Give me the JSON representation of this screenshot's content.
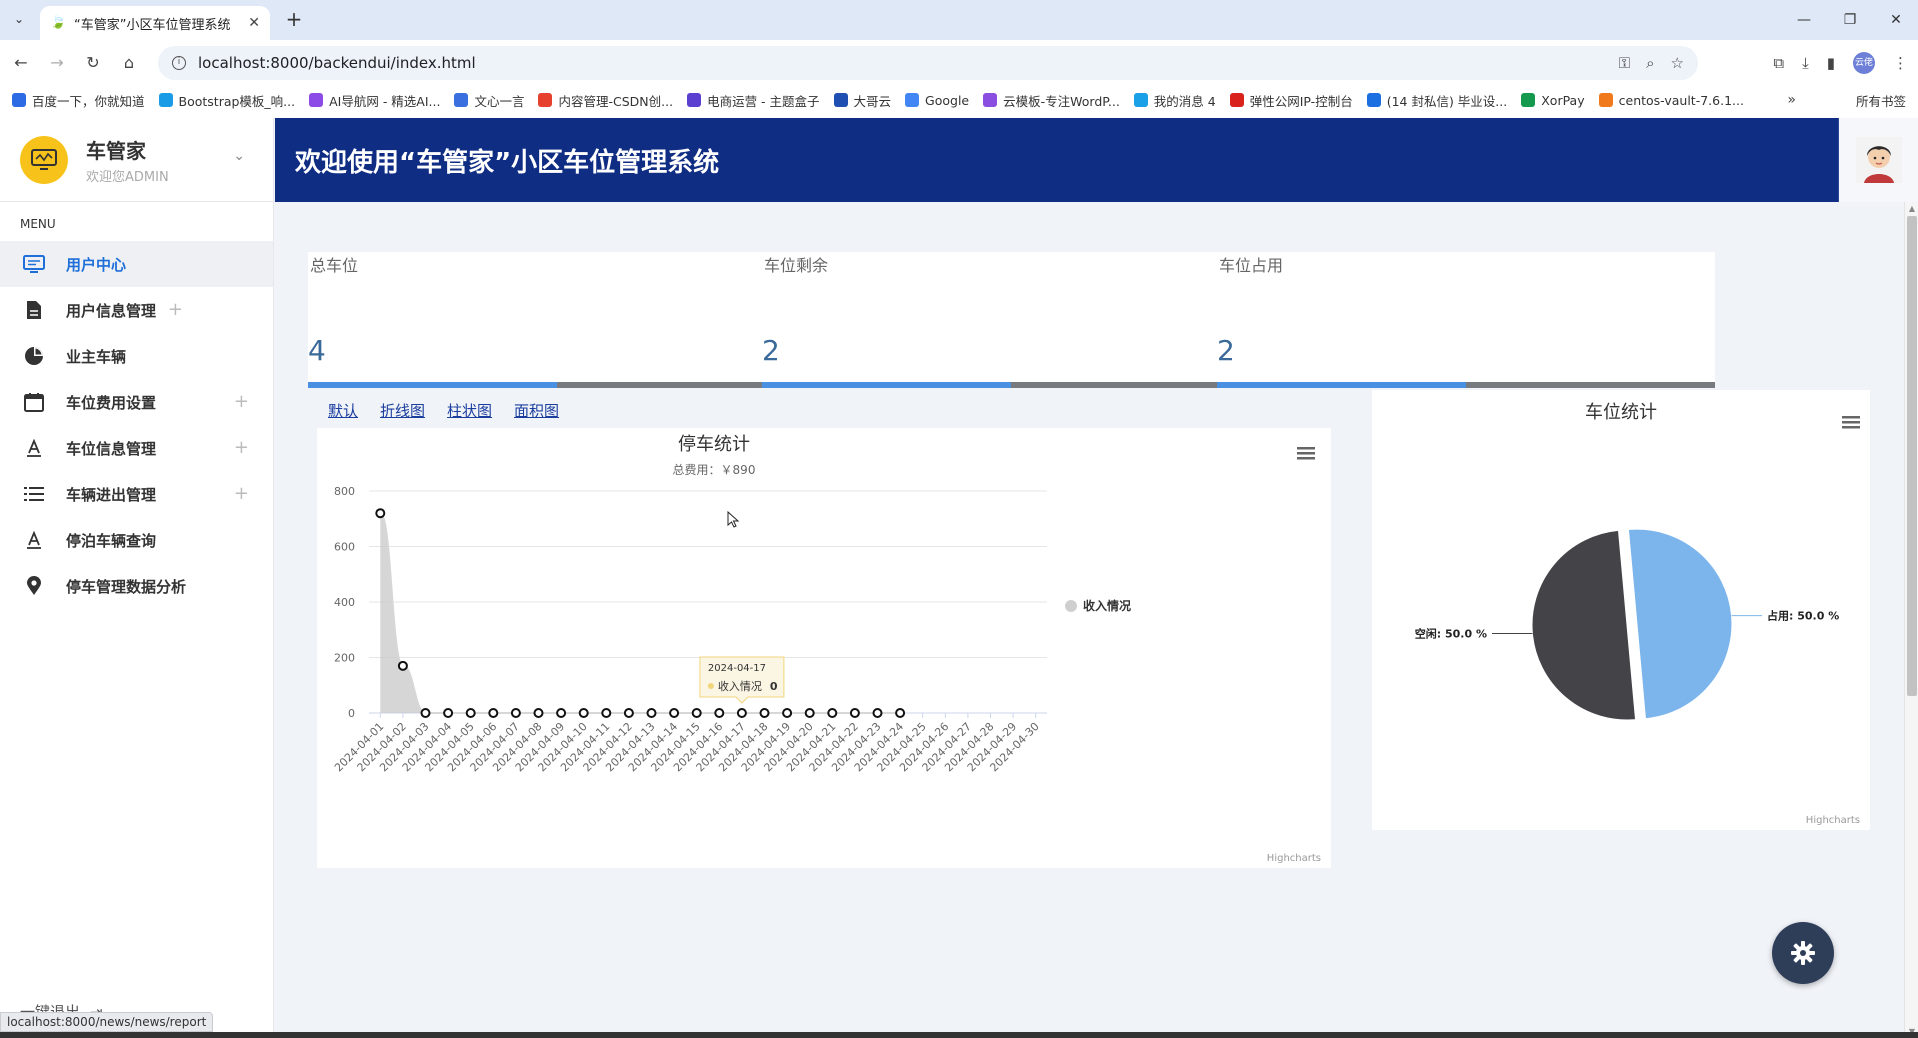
{
  "browser": {
    "tab_title": "“车管家”小区车位管理系统",
    "url": "localhost:8000/backendui/index.html",
    "profile": "云佬",
    "bookmarks": [
      {
        "label": "百度一下，你就知道",
        "color": "#2d6be4"
      },
      {
        "label": "Bootstrap模板_响...",
        "color": "#1a9be6"
      },
      {
        "label": "AI导航网 - 精选AI...",
        "color": "#8c4be6"
      },
      {
        "label": "文心一言",
        "color": "#3a6fe0"
      },
      {
        "label": "内容管理-CSDN创...",
        "color": "#e6402f"
      },
      {
        "label": "电商运营 - 主题盒子",
        "color": "#5b3fd1"
      },
      {
        "label": "大哥云",
        "color": "#1f4fb0"
      },
      {
        "label": "Google",
        "color": "#4285f4"
      },
      {
        "label": "云模板-专注WordP...",
        "color": "#8a4ee0"
      },
      {
        "label": "我的消息 4",
        "color": "#1aa0e6"
      },
      {
        "label": "弹性公网IP-控制台",
        "color": "#d9221c"
      },
      {
        "label": "(14 封私信) 毕业设...",
        "color": "#1b6fe0"
      },
      {
        "label": "XorPay",
        "color": "#15994f"
      },
      {
        "label": "centos-vault-7.6.1...",
        "color": "#f07a1b"
      }
    ],
    "all_bookmarks": "所有书签",
    "status_url": "localhost:8000/news/news/report"
  },
  "sidebar": {
    "brand_name": "车管家",
    "brand_sub": "欢迎您ADMIN",
    "menu_title": "MENU",
    "items": [
      {
        "label": "用户中心",
        "icon": "monitor-icon",
        "has_plus": false,
        "active": true
      },
      {
        "label": "用户信息管理",
        "icon": "document-icon",
        "has_plus": true,
        "active": false
      },
      {
        "label": "业主车辆",
        "icon": "pie-chart-icon",
        "has_plus": false,
        "active": false
      },
      {
        "label": "车位费用设置",
        "icon": "calendar-icon",
        "has_plus": true,
        "active": false
      },
      {
        "label": "车位信息管理",
        "icon": "letter-a-icon",
        "has_plus": true,
        "active": false
      },
      {
        "label": "车辆进出管理",
        "icon": "list-icon",
        "has_plus": true,
        "active": false
      },
      {
        "label": "停泊车辆查询",
        "icon": "letter-a-icon",
        "has_plus": false,
        "active": false
      },
      {
        "label": "停车管理数据分析",
        "icon": "location-pin-icon",
        "has_plus": false,
        "active": false
      }
    ],
    "logout": "一键退出"
  },
  "header": {
    "title": "欢迎使用“车管家”小区车位管理系统"
  },
  "stats": [
    {
      "label": "总车位",
      "value": "4",
      "fill": 0.5
    },
    {
      "label": "车位剩余",
      "value": "2",
      "fill": 0.5
    },
    {
      "label": "车位占用",
      "value": "2",
      "fill": 0.5
    }
  ],
  "chart_links": [
    "默认",
    "折线图",
    "柱状图",
    "面积图"
  ],
  "chart_data": [
    {
      "type": "area",
      "title": "停车统计",
      "subtitle": "总费用：￥890",
      "xlabel": "",
      "ylabel": "",
      "ylim": [
        0,
        800
      ],
      "yticks": [
        0,
        200,
        400,
        600,
        800
      ],
      "categories": [
        "2024-04-01",
        "2024-04-02",
        "2024-04-03",
        "2024-04-04",
        "2024-04-05",
        "2024-04-06",
        "2024-04-07",
        "2024-04-08",
        "2024-04-09",
        "2024-04-10",
        "2024-04-11",
        "2024-04-12",
        "2024-04-13",
        "2024-04-14",
        "2024-04-15",
        "2024-04-16",
        "2024-04-17",
        "2024-04-18",
        "2024-04-19",
        "2024-04-20",
        "2024-04-21",
        "2024-04-22",
        "2024-04-23",
        "2024-04-24",
        "2024-04-25",
        "2024-04-26",
        "2024-04-27",
        "2024-04-28",
        "2024-04-29",
        "2024-04-30"
      ],
      "series": [
        {
          "name": "收入情况",
          "values": [
            720,
            170,
            0,
            0,
            0,
            0,
            0,
            0,
            0,
            0,
            0,
            0,
            0,
            0,
            0,
            0,
            0,
            0,
            0,
            0,
            0,
            0,
            0,
            0
          ]
        }
      ],
      "legend": "right",
      "grid": true,
      "tooltip": {
        "date": "2024-04-17",
        "label": "收入情况",
        "value": "0"
      },
      "credits": "Highcharts"
    },
    {
      "type": "pie",
      "title": "车位统计",
      "slices": [
        {
          "label": "占用",
          "value": 50.0,
          "text": "占用: 50.0 %",
          "color": "#7cb5ec"
        },
        {
          "label": "空闲",
          "value": 50.0,
          "text": "空闲: 50.0 %",
          "color": "#434348"
        }
      ],
      "credits": "Highcharts"
    }
  ]
}
